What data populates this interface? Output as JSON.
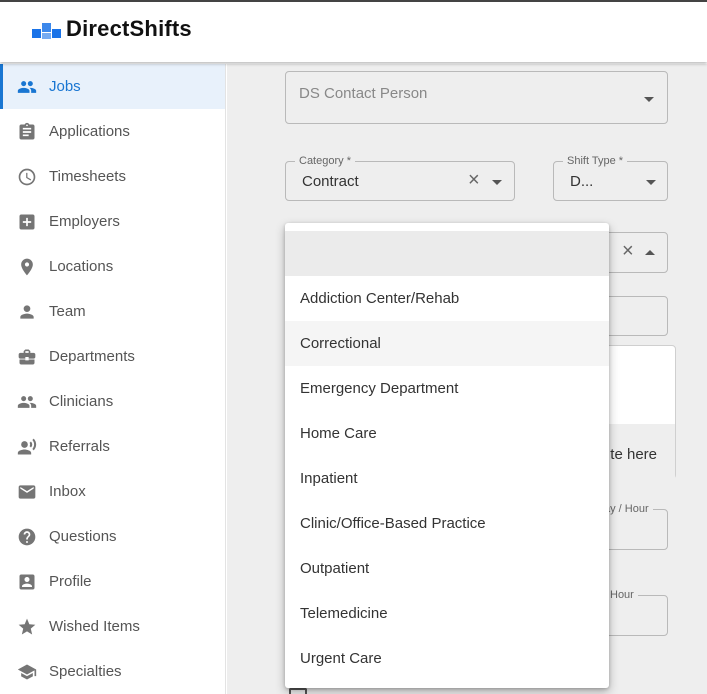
{
  "brand": {
    "name": "DirectShifts",
    "accent": "#1a73e8",
    "logo_icon": "pixel-squares-logo"
  },
  "sidebar": {
    "items": [
      {
        "label": "Jobs",
        "icon": "people-icon",
        "active": true
      },
      {
        "label": "Applications",
        "icon": "clipboard-icon"
      },
      {
        "label": "Timesheets",
        "icon": "clock-icon"
      },
      {
        "label": "Employers",
        "icon": "medical-plus-icon"
      },
      {
        "label": "Locations",
        "icon": "location-pin-icon"
      },
      {
        "label": "Team",
        "icon": "person-icon"
      },
      {
        "label": "Departments",
        "icon": "briefcase-icon"
      },
      {
        "label": "Clinicians",
        "icon": "people-icon"
      },
      {
        "label": "Referrals",
        "icon": "record-voice-icon"
      },
      {
        "label": "Inbox",
        "icon": "mail-icon"
      },
      {
        "label": "Questions",
        "icon": "help-circle-icon"
      },
      {
        "label": "Profile",
        "icon": "account-box-icon"
      },
      {
        "label": "Wished Items",
        "icon": "star-icon"
      },
      {
        "label": "Specialties",
        "icon": "school-icon"
      }
    ],
    "active_color": "#1976d2"
  },
  "form": {
    "contact_placeholder": "DS Contact Person",
    "category_label": "Category *",
    "category_value": "Contract",
    "shift_type_label": "Shift Type *",
    "shift_type_value": "D...",
    "card_hint": "te here",
    "pay_label_partial": "ay / Hour",
    "hour_label_partial": "Hour"
  },
  "dropdown": {
    "options": [
      "",
      "Addiction Center/Rehab",
      "Correctional",
      "Emergency Department",
      "Home Care",
      "Inpatient",
      "Clinic/Office-Based Practice",
      "Outpatient",
      "Telemedicine",
      "Urgent Care"
    ],
    "hovered": "Correctional"
  }
}
